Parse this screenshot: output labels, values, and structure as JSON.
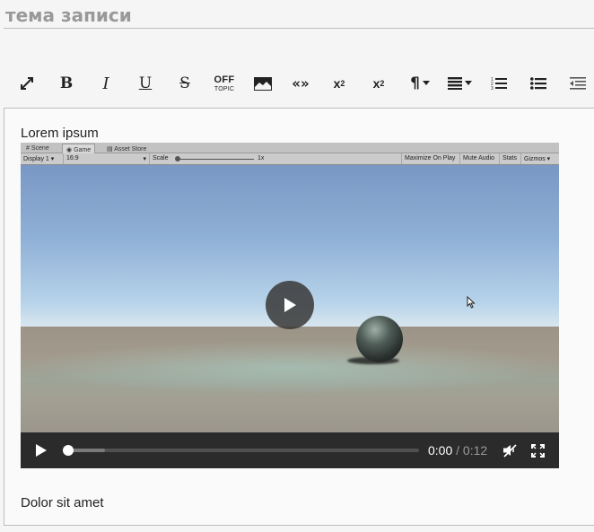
{
  "title_field": {
    "placeholder": "тема записи"
  },
  "toolbar": {
    "fullscreen_icon": "expand-arrows-icon",
    "bold_label": "B",
    "italic_label": "I",
    "underline_label": "U",
    "strike_label": "S",
    "offtopic_line1": "OFF",
    "offtopic_line2": "TOPIC",
    "image_icon": "image-icon",
    "quote_label": "«»",
    "subscript_label": "x",
    "subscript_sub": "2",
    "superscript_label": "x",
    "superscript_sup": "2",
    "paragraph_label": "¶",
    "align_icon": "align-dropdown-icon",
    "ordered_list_icon": "ordered-list-icon",
    "bullet_list_icon": "bullet-list-icon",
    "outdent_icon": "outdent-icon"
  },
  "editor": {
    "paragraph_1": "Lorem ipsum",
    "paragraph_2": "Dolor sit amet"
  },
  "video": {
    "unity_tabs": [
      "Scene",
      "Game",
      "Asset Store"
    ],
    "unity_bar": {
      "display": "Display 1",
      "aspect": "16:9",
      "scale_label": "Scale",
      "scale_value": "1x",
      "maximize": "Maximize On Play",
      "mute": "Mute Audio",
      "stats": "Stats",
      "gizmos": "Gizmos"
    },
    "current_time": "0:00",
    "separator": " / ",
    "duration": "0:12",
    "progress": 0.0,
    "muted": true
  }
}
